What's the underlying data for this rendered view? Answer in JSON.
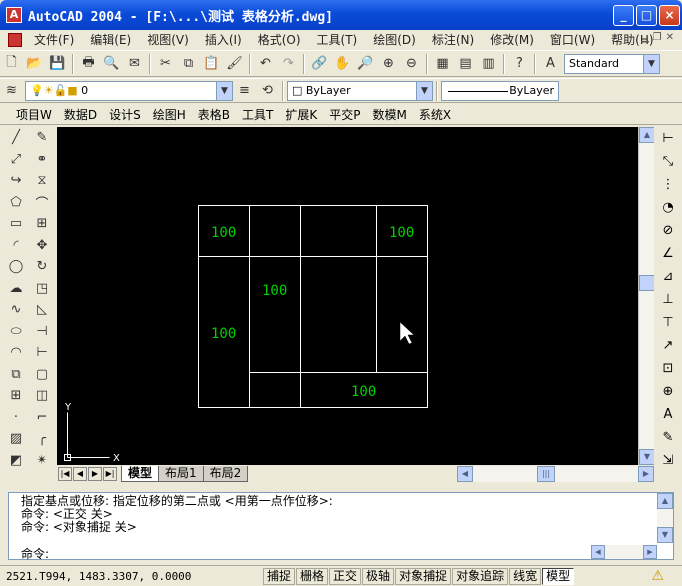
{
  "window": {
    "title": "AutoCAD 2004 - [F:\\...\\测试 表格分析.dwg]",
    "buttons": [
      "_",
      "□",
      "×"
    ]
  },
  "menu": {
    "items": [
      "文件(F)",
      "编辑(E)",
      "视图(V)",
      "插入(I)",
      "格式(O)",
      "工具(T)",
      "绘图(D)",
      "标注(N)",
      "修改(M)",
      "窗口(W)",
      "帮助(H)"
    ]
  },
  "toolbar_layers": {
    "layer_value": "0",
    "color_value": "ByLayer",
    "linetype_value": "ByLayer"
  },
  "toolbar_standard": {
    "text_style": "Standard"
  },
  "tianzheng_menu": {
    "items": [
      "项目W",
      "数据D",
      "设计S",
      "绘图H",
      "表格B",
      "工具T",
      "扩展K",
      "平交P",
      "数模M",
      "系统X"
    ]
  },
  "drawing": {
    "cells_text": [
      "100",
      "100",
      "100",
      "100",
      "100"
    ],
    "ucs": {
      "x_label": "X",
      "y_label": "Y"
    },
    "colors": {
      "background": "#000000",
      "lines": "#ffffff",
      "text": "#00d000"
    }
  },
  "layout_tabs": [
    "模型",
    "布局1",
    "布局2"
  ],
  "command": {
    "history": [
      "指定基点或位移: 指定位移的第二点或 <用第一点作位移>:",
      "命令:  <正交 关>",
      "命令:  <对象捕捉 关>"
    ],
    "prompt": "命令:"
  },
  "status": {
    "coordinates": "2521.T994, 1483.3307, 0.0000",
    "toggles": [
      "捕捉",
      "栅格",
      "正交",
      "极轴",
      "对象捕捉",
      "对象追踪",
      "线宽",
      "模型"
    ]
  }
}
